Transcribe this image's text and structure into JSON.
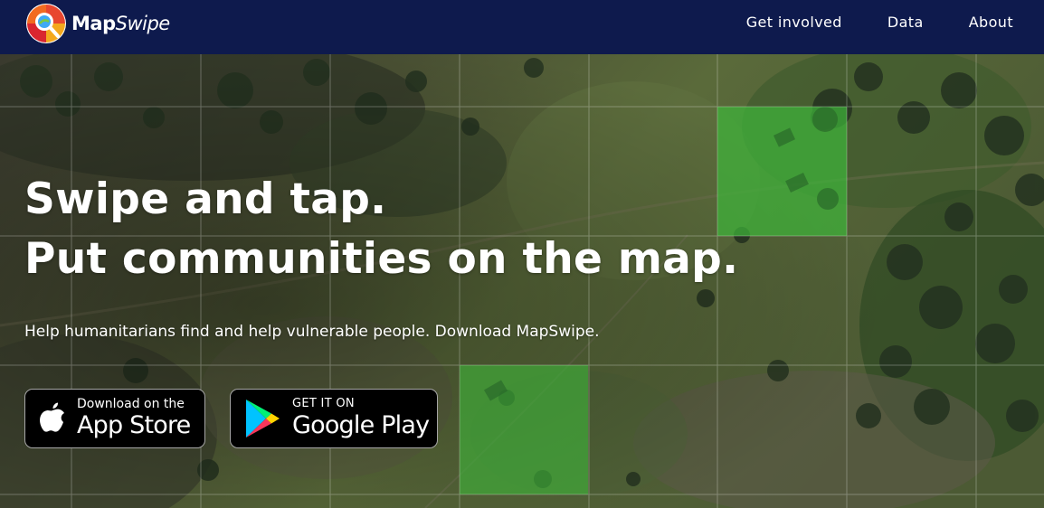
{
  "brand": {
    "name_bold": "Map",
    "name_italic": "Swipe"
  },
  "nav": {
    "links": [
      {
        "label": "Get involved"
      },
      {
        "label": "Data"
      },
      {
        "label": "About"
      }
    ]
  },
  "hero": {
    "headline_line1": "Swipe and tap.",
    "headline_line2": "Put communities on the map.",
    "subtitle": "Help humanitarians find and help vulnerable people. Download MapSwipe."
  },
  "store_buttons": {
    "apple": {
      "small": "Download on the",
      "big": "App Store",
      "icon": "apple-icon"
    },
    "google": {
      "small": "GET IT ON",
      "big": "Google Play",
      "icon": "google-play-icon"
    }
  },
  "colors": {
    "navbar": "#0e1a4d",
    "highlight_tile": "#3fb43a",
    "button_bg": "#000000",
    "text": "#ffffff"
  }
}
